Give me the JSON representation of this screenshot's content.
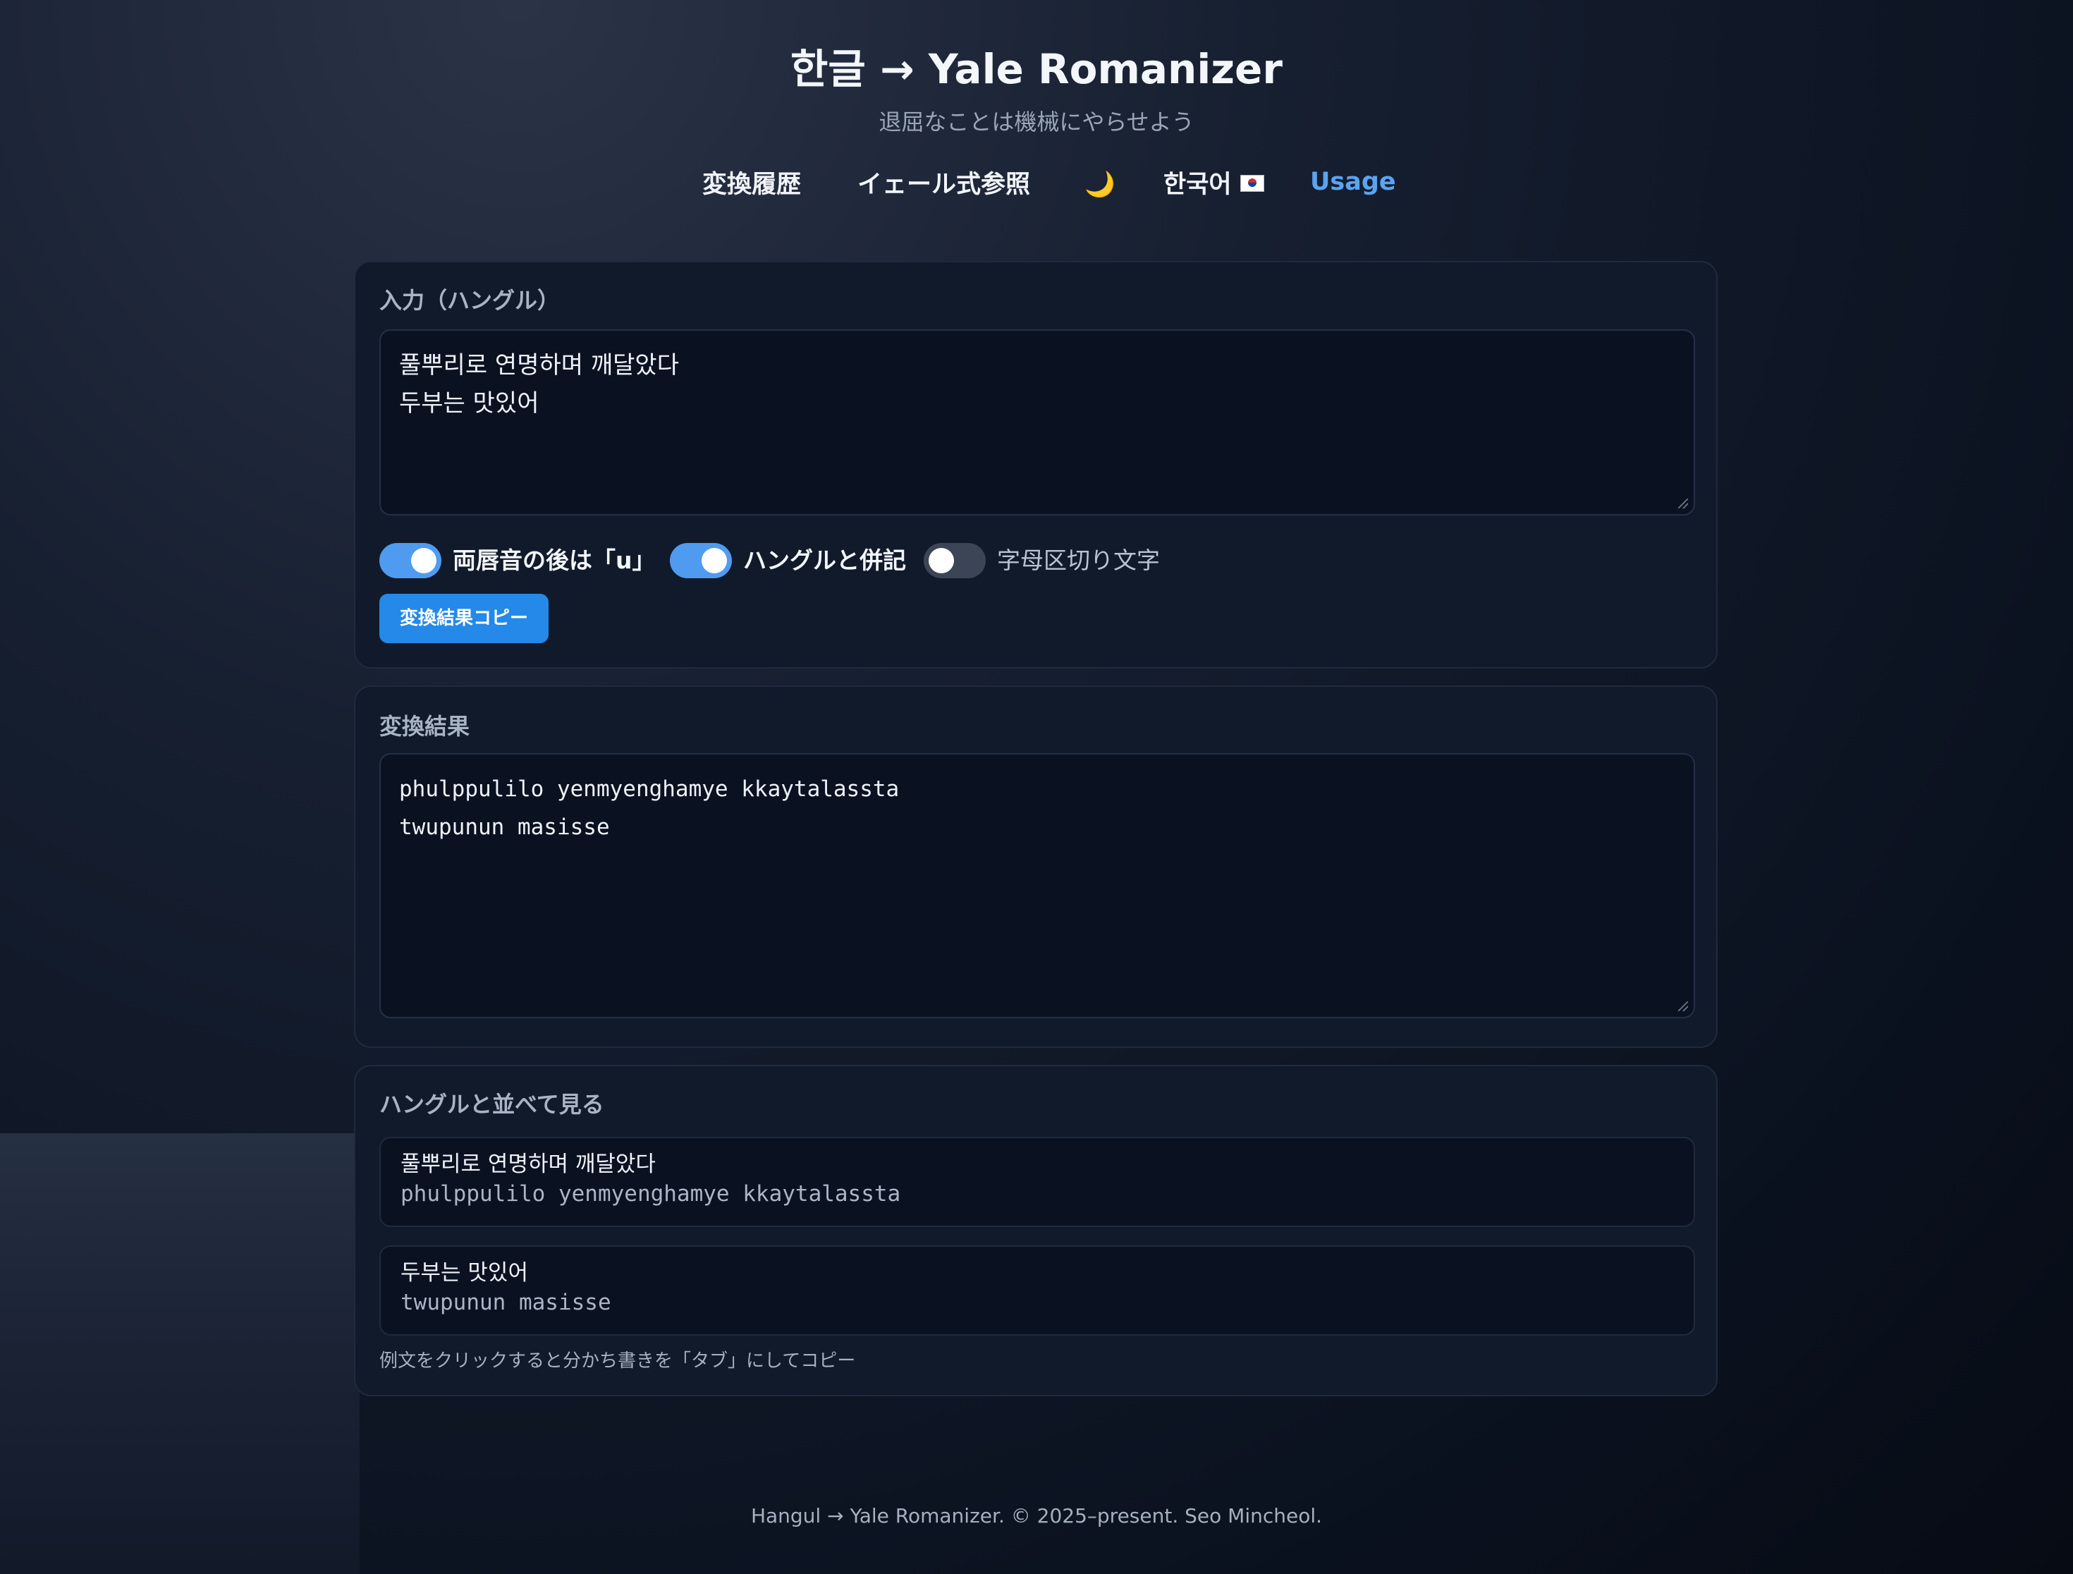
{
  "header": {
    "title": "한글 → Yale Romanizer",
    "subtitle": "退屈なことは機械にやらせよう"
  },
  "nav": {
    "history": "変換履歴",
    "yale_reference": "イェール式参照",
    "theme_icon": "🌙",
    "language": "한국어",
    "language_flag_icon": "korea-flag-icon",
    "usage": "Usage"
  },
  "input_card": {
    "label": "入力（ハングル）",
    "value": "풀뿌리로 연명하며 깨달았다\n두부는 맛있어",
    "toggles": [
      {
        "label": "両唇音の後は「u」",
        "on": true
      },
      {
        "label": "ハングルと併記",
        "on": true
      },
      {
        "label": "字母区切り文字",
        "on": false
      }
    ],
    "copy_button": "変換結果コピー"
  },
  "result_card": {
    "label": "変換結果",
    "value": "phulppulilo yenmyenghamye kkaytalassta\ntwupunun masisse"
  },
  "side_by_side": {
    "label": "ハングルと並べて見る",
    "pairs": [
      {
        "hangul": "풀뿌리로 연명하며 깨달았다",
        "yale": "phulppulilo yenmyenghamye kkaytalassta"
      },
      {
        "hangul": "두부는 맛있어",
        "yale": "twupunun masisse"
      }
    ],
    "hint": "例文をクリックすると分かち書きを「タブ」にしてコピー"
  },
  "footer": {
    "text": "Hangul → Yale Romanizer. © 2025–present. Seo Mincheol."
  },
  "colors": {
    "accent": "#2489e8",
    "toggle_on": "#4f9bf0",
    "link": "#5aa4f0"
  }
}
